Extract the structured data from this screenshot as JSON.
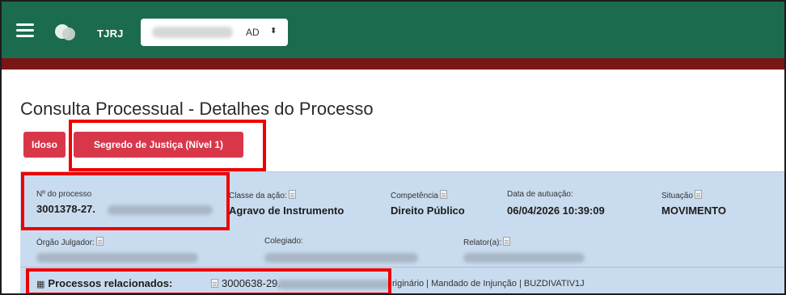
{
  "topbar": {
    "brand": "TJRJ",
    "selector_value": "AD",
    "selector_caret": "⬍"
  },
  "page": {
    "title": "Consulta Processual - Detalhes do Processo"
  },
  "badges": {
    "idoso": "Idoso",
    "segredo": "Segredo de Justiça (Nível 1)"
  },
  "details": {
    "numero_label": "Nº do processo",
    "numero_value": "3001378-27.",
    "classe_label": "Classe da ação:",
    "classe_value": "Agravo de Instrumento",
    "competencia_label": "Competência",
    "competencia_value": "Direito Público",
    "data_label": "Data de autuação:",
    "data_value": "06/04/2026 10:39:09",
    "situacao_label": "Situação",
    "situacao_value": "MOVIMENTO",
    "orgao_label": "Órgão Julgador:",
    "colegiado_label": "Colegiado:",
    "relator_label": "Relator(a):"
  },
  "related": {
    "label": "Processos relacionados:",
    "number": "3000638-29.",
    "info": "riginário | Mandado de Injunção | BUZDIVATIV1J"
  },
  "colors": {
    "topbar": "#1b6b4f",
    "accent_bar": "#7a1616",
    "badge": "#d8374a",
    "panel": "#c9dbee",
    "highlight": "#ee0000"
  }
}
